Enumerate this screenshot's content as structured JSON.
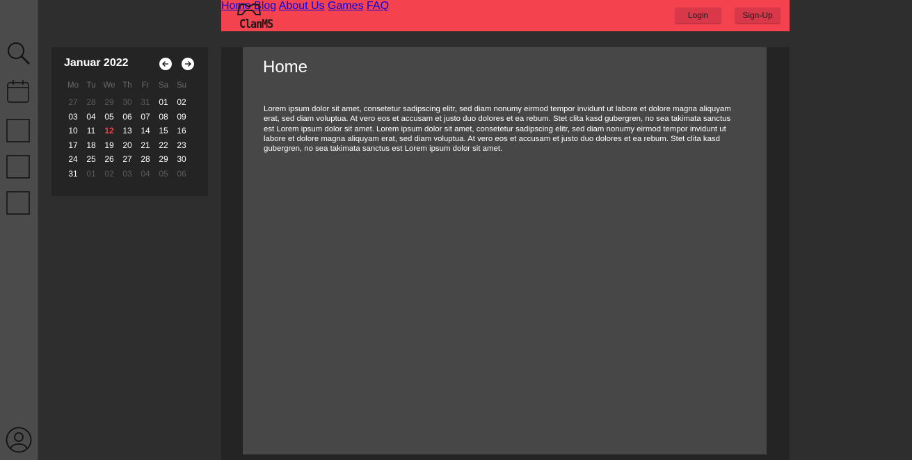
{
  "sidebar": {
    "icons": [
      {
        "name": "search-icon"
      },
      {
        "name": "calendar-icon"
      },
      {
        "name": "square-icon"
      },
      {
        "name": "square-icon"
      },
      {
        "name": "square-icon"
      },
      {
        "name": "user-profile-icon"
      }
    ]
  },
  "header": {
    "brand": "ClanMS",
    "logo_icon": "gamepad-icon",
    "nav": [
      "Home",
      "Blog",
      "About Us",
      "Games",
      "FAQ"
    ],
    "login_label": "Login",
    "signup_label": "Sign-Up",
    "accent_color": "#f4424f"
  },
  "calendar": {
    "title": "Januar 2022",
    "prev_icon": "arrow-left-icon",
    "next_icon": "arrow-right-icon",
    "weekdays": [
      "Mo",
      "Tu",
      "We",
      "Th",
      "Fr",
      "Sa",
      "Su"
    ],
    "weeks": [
      [
        "27",
        "28",
        "29",
        "30",
        "31",
        "01",
        "02"
      ],
      [
        "03",
        "04",
        "05",
        "06",
        "07",
        "08",
        "09"
      ],
      [
        "10",
        "11",
        "12",
        "13",
        "14",
        "15",
        "16"
      ],
      [
        "17",
        "18",
        "19",
        "20",
        "21",
        "22",
        "23"
      ],
      [
        "24",
        "25",
        "26",
        "27",
        "28",
        "29",
        "30"
      ],
      [
        "31",
        "01",
        "02",
        "03",
        "04",
        "05",
        "06"
      ]
    ],
    "today": "12"
  },
  "main": {
    "title": "Home",
    "body": "Lorem ipsum dolor sit amet, consetetur sadipscing elitr, sed diam nonumy eirmod tempor invidunt ut labore et dolore magna aliquyam erat, sed diam voluptua. At vero eos et accusam et justo duo dolores et ea rebum. Stet clita kasd gubergren, no sea takimata sanctus est Lorem ipsum dolor sit amet. Lorem ipsum dolor sit amet, consetetur sadipscing elitr, sed diam nonumy eirmod tempor invidunt ut labore et dolore magna aliquyam erat, sed diam voluptua. At vero eos et accusam et justo duo dolores et ea rebum. Stet clita kasd gubergren, no sea takimata sanctus est Lorem ipsum dolor sit amet."
  }
}
